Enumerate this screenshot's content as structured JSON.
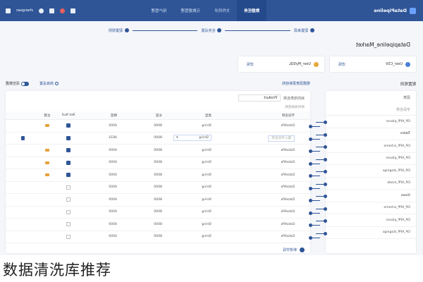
{
  "topnav": {
    "brand": "DataPipeline",
    "tabs": [
      {
        "label": "数据任务",
        "active": true
      },
      {
        "label": "文件同步",
        "active": false
      },
      {
        "label": "元数据管理",
        "active": false
      },
      {
        "label": "用户管理",
        "active": false
      }
    ],
    "user": "zhangsan"
  },
  "steps": [
    {
      "label": "配置来源"
    },
    {
      "label": "任务设置"
    },
    {
      "label": "配置规则"
    }
  ],
  "page_title": "Datapipeline_Market",
  "sources": {
    "target": {
      "name": "User_CSV",
      "link": "详情"
    },
    "source": {
      "name": "User_MySQL",
      "link": "详情"
    }
  },
  "rules_title": "配置规则",
  "left": {
    "header": "源表",
    "column": "字段名称",
    "rows": [
      "OP_APP_places",
      "Tables",
      "OP_APP_scheme",
      "OP_APP_places",
      "OP_APP_stagings",
      "OP_APP_made",
      "Views",
      "OP_APP_scheme",
      "OP_APP_places",
      "OP_APP_stagings"
    ]
  },
  "right": {
    "tools": {
      "left_link": "根据源表更新结构",
      "advanced": "高级设置",
      "toggle_label": "清空数据"
    },
    "table_name_label": "目的地表名称",
    "table_name_value": "Product",
    "sub_label": "目的地表结构",
    "headers": [
      "",
      "字段名称",
      "类型",
      "长度",
      "精度",
      "Not Null",
      "主键",
      ""
    ],
    "rows": [
      {
        "name": "DataAPa",
        "type": "String",
        "len": "8000",
        "prec": "4000",
        "nn": true,
        "pk": true
      },
      {
        "name": "输入字段名称",
        "type": "String",
        "len": "8000",
        "prec": "4833",
        "nn": true,
        "pk": false,
        "editing": true
      },
      {
        "name": "DataAPa",
        "type": "String",
        "len": "8000",
        "prec": "4000",
        "nn": true,
        "pk": true
      },
      {
        "name": "DataAPa",
        "type": "String",
        "len": "8000",
        "prec": "4000",
        "nn": true,
        "pk": true
      },
      {
        "name": "DataAPa",
        "type": "String",
        "len": "8000",
        "prec": "4000",
        "nn": true,
        "pk": true
      },
      {
        "name": "DataAPa",
        "type": "String",
        "len": "8000",
        "prec": "4000",
        "nn": false,
        "pk": false
      },
      {
        "name": "DataAPa",
        "type": "String",
        "len": "8000",
        "prec": "4000",
        "nn": false,
        "pk": false
      },
      {
        "name": "DataAPa",
        "type": "String",
        "len": "8000",
        "prec": "4000",
        "nn": false,
        "pk": false
      },
      {
        "name": "DataAPa",
        "type": "String",
        "len": "8000",
        "prec": "4000",
        "nn": false,
        "pk": false
      },
      {
        "name": "DataAPa",
        "type": "String",
        "len": "8000",
        "prec": "4000",
        "nn": false,
        "pk": false
      }
    ],
    "add_label": "新增字段"
  },
  "caption": "数据清洗库推荐"
}
